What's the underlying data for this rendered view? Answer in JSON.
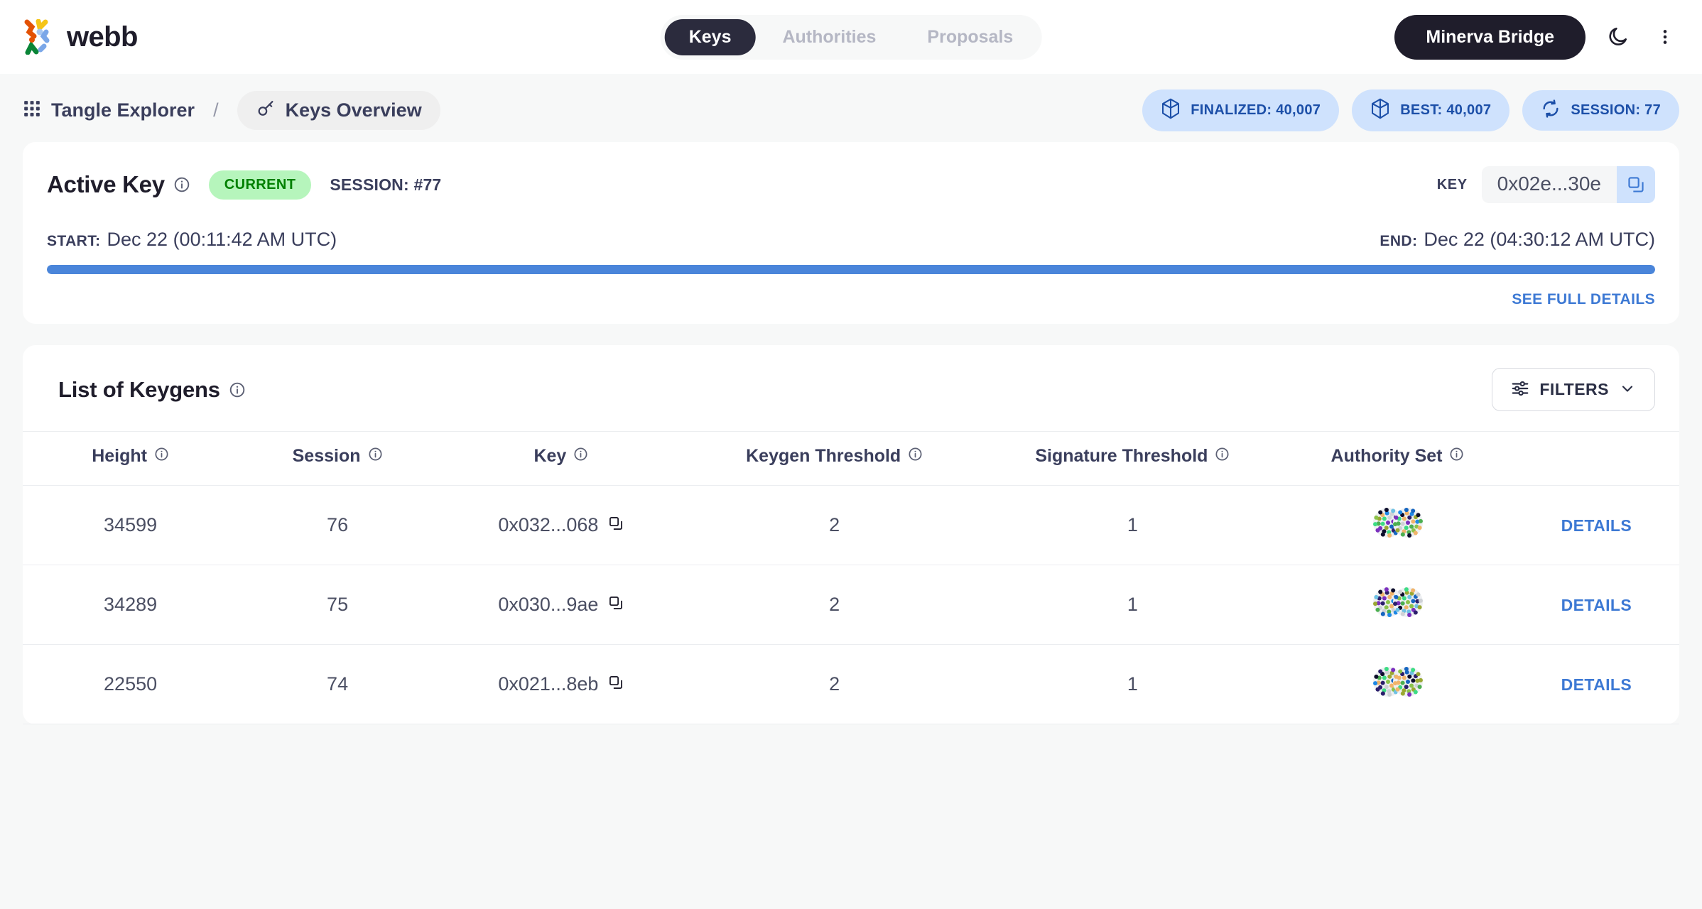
{
  "header": {
    "brand": "webb",
    "logo_icon": "webb-logo-icon",
    "tabs": [
      {
        "label": "Keys",
        "active": true
      },
      {
        "label": "Authorities",
        "active": false
      },
      {
        "label": "Proposals",
        "active": false
      }
    ],
    "chain_button": "Minerva Bridge",
    "dark_mode_icon": "moon-icon",
    "more_menu_icon": "vertical-dots-icon"
  },
  "breadcrumb": {
    "grid_icon": "grid-apps-icon",
    "root": "Tangle Explorer",
    "separator": "/",
    "current_icon": "key-icon",
    "current": "Keys Overview"
  },
  "stats": [
    {
      "icon": "cube-icon",
      "label": "FINALIZED: 40,007"
    },
    {
      "icon": "cube-icon",
      "label": "BEST: 40,007"
    },
    {
      "icon": "refresh-icon",
      "label": "SESSION: 77"
    }
  ],
  "active_key": {
    "title": "Active Key",
    "info_icon": "info-icon",
    "status_badge": "CURRENT",
    "session": "SESSION: #77",
    "key_label": "KEY",
    "key_value": "0x02e...30e",
    "copy_icon": "copy-icon",
    "start_label": "START:",
    "start_value": "Dec 22 (00:11:42 AM UTC)",
    "end_label": "END:",
    "end_value": "Dec 22 (04:30:12 AM UTC)",
    "progress_percent": 100,
    "see_full_details": "SEE FULL DETAILS"
  },
  "keygens": {
    "title": "List of Keygens",
    "info_icon": "info-icon",
    "filters_label": "FILTERS",
    "filters_icon": "sliders-icon",
    "filters_chevron_icon": "chevron-down-icon",
    "columns": [
      "Height",
      "Session",
      "Key",
      "Keygen Threshold",
      "Signature Threshold",
      "Authority Set",
      ""
    ],
    "rows": [
      {
        "height": "34599",
        "session": "76",
        "key": "0x032...068",
        "copy_icon": "copy-icon",
        "keygen_threshold": "2",
        "signature_threshold": "1",
        "authority_set_icon": "identicon-avatar-group",
        "details": "DETAILS"
      },
      {
        "height": "34289",
        "session": "75",
        "key": "0x030...9ae",
        "copy_icon": "copy-icon",
        "keygen_threshold": "2",
        "signature_threshold": "1",
        "authority_set_icon": "identicon-avatar-group",
        "details": "DETAILS"
      },
      {
        "height": "22550",
        "session": "74",
        "key": "0x021...8eb",
        "copy_icon": "copy-icon",
        "keygen_threshold": "2",
        "signature_threshold": "1",
        "authority_set_icon": "identicon-avatar-group",
        "details": "DETAILS"
      }
    ]
  },
  "colors": {
    "page_bg": "#f7f8f8",
    "card_bg": "#ffffff",
    "accent_blue": "#3d79d4",
    "progress_blue": "#4a85da",
    "chip_bg": "#cfe2fd",
    "chip_text": "#1c4fa8",
    "badge_bg": "#b6f5bc",
    "badge_text": "#008000",
    "dark": "#1f1d2b",
    "muted": "#b5b7c4"
  }
}
